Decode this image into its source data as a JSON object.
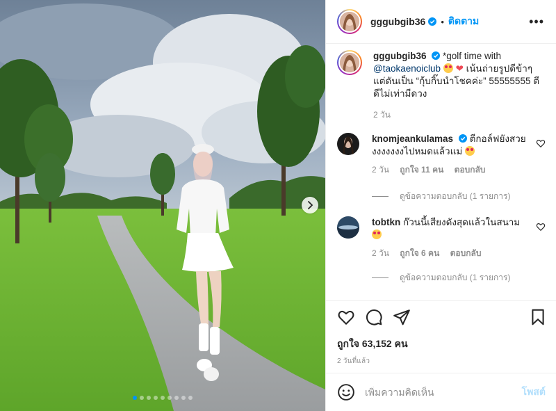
{
  "header": {
    "username": "gggubgib36",
    "separator": "•",
    "follow_label": "ติดตาม",
    "more_label": "•••"
  },
  "caption": {
    "username": "gggubgib36",
    "text_1": "*golf time with",
    "mention": "@taokaenoiclub",
    "heart": "❤",
    "text_2": "เน้นถ่ายรูปดีข้าๆ แต่ดันเป็น “กุ้บกิ๊บนำโชคค่ะ” 55555555 ตีดีไม่เท่ามีดวง",
    "time": "2 วัน"
  },
  "comments": [
    {
      "username": "knomjeankulamas",
      "text": "ตีกอล์ฟยังสวย งงงงงงงไปหมดแล้วแม่",
      "time": "2 วัน",
      "likes": "ถูกใจ 11 คน",
      "reply_label": "ตอบกลับ",
      "view_replies": "ดูข้อความตอบกลับ (1 รายการ)"
    },
    {
      "username": "tobtkn",
      "text": "ก๊วนนี้เสียงดังสุดแล้วในสนาม",
      "time": "2 วัน",
      "likes": "ถูกใจ 6 คน",
      "reply_label": "ตอบกลับ",
      "view_replies": "ดูข้อความตอบกลับ (1 รายการ)"
    }
  ],
  "stats": {
    "likes": "ถูกใจ 63,152 คน",
    "time_ago": "2 วันที่แล้ว"
  },
  "composer": {
    "placeholder": "เพิ่มความคิดเห็น",
    "post_label": "โพสต์"
  },
  "carousel": {
    "slide_count": 9,
    "active_index": 0
  },
  "colors": {
    "accent": "#0095f6",
    "heart": "#ed4956",
    "muted": "#8e8e8e"
  },
  "icons": [
    "verified-badge-icon",
    "heart-icon",
    "comment-icon",
    "share-icon",
    "bookmark-icon",
    "emoji-icon",
    "chevron-right-icon"
  ]
}
